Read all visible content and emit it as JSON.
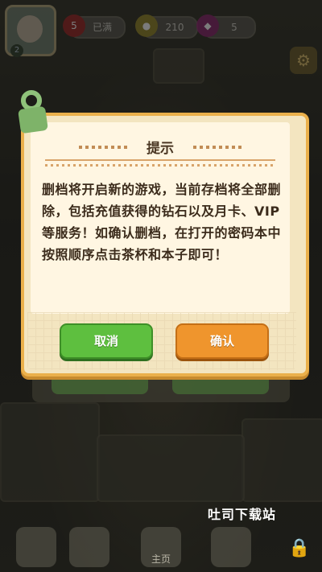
{
  "hud": {
    "hearts_count": "5",
    "hearts_label": "已满",
    "coins": "210",
    "gems": "5",
    "avatar_level": "2"
  },
  "dialog": {
    "title": "提示",
    "message": "删档将开启新的游戏，当前存档将全部删除，包括充值获得的钻石以及月卡、VIP等服务！如确认删档，在打开的密码本中按照顺序点击茶杯和本子即可！",
    "cancel_label": "取消",
    "confirm_label": "确认"
  },
  "bottom_nav": {
    "home_label": "主页"
  },
  "watermark": "吐司下载站",
  "colors": {
    "dialog_border": "#eab04b",
    "paper": "#fff6e2",
    "cancel_button": "#5ebf3f",
    "confirm_button": "#ef952d"
  }
}
